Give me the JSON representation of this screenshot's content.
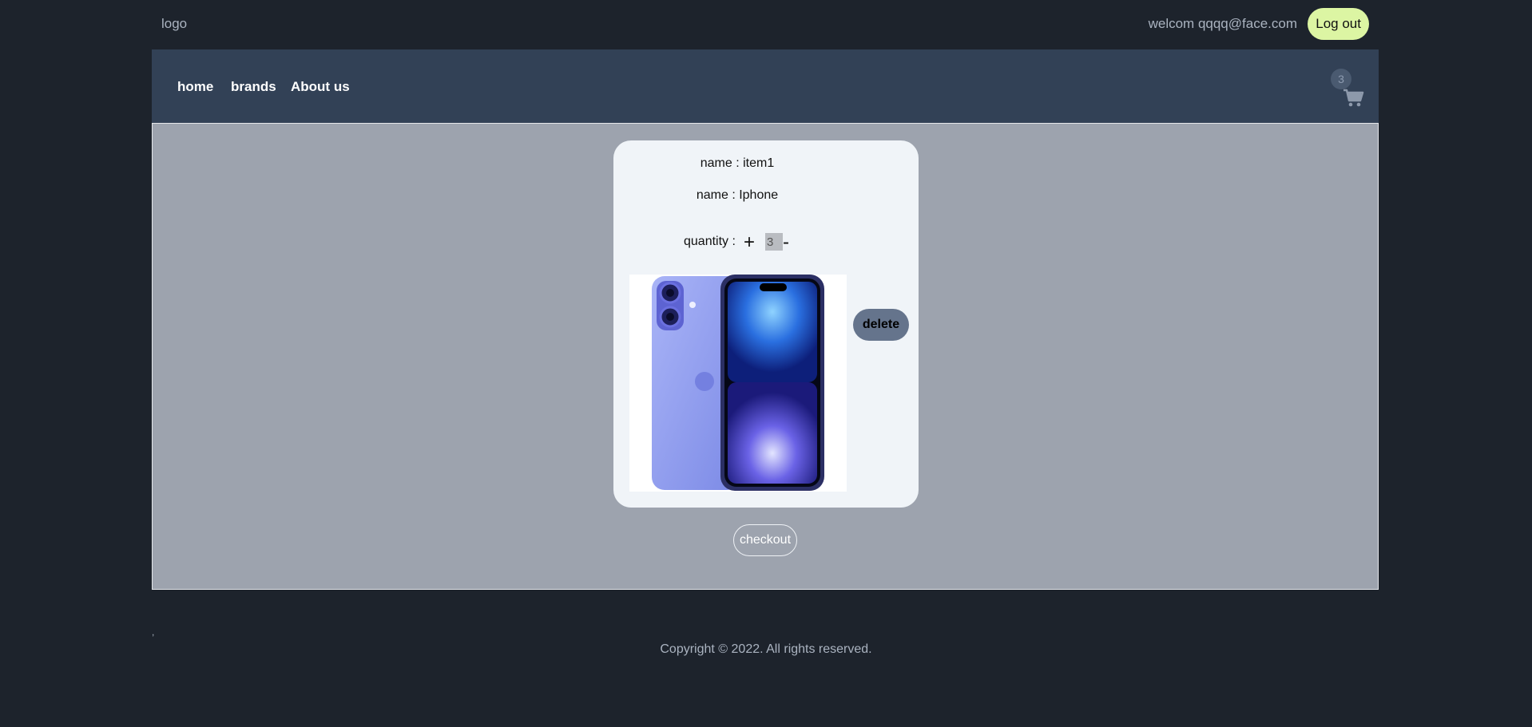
{
  "header": {
    "logo_text": "logo",
    "welcome_text": "welcom qqqq@face.com",
    "logout_label": "Log out"
  },
  "nav": {
    "links": [
      "home",
      "brands",
      "About us"
    ],
    "cart_count": "3",
    "cart_icon": "cart-icon"
  },
  "cart_item": {
    "name_line_1": "name : item1",
    "name_line_2": "name : Iphone",
    "quantity_label": "quantity :",
    "increment_symbol": "+",
    "quantity_value": "3",
    "decrement_symbol": "-",
    "delete_label": "delete",
    "product_image": "iphone-blue-image"
  },
  "checkout_label": "checkout",
  "footer": {
    "mark": ",",
    "copyright": "Copyright © 2022. All rights reserved."
  },
  "colors": {
    "page_bg": "#1d232c",
    "nav_bg": "#324156",
    "main_bg": "#9da3ae",
    "card_bg": "#f0f4f8",
    "logout_bg": "#dcf5a3",
    "delete_bg": "#65748c"
  }
}
